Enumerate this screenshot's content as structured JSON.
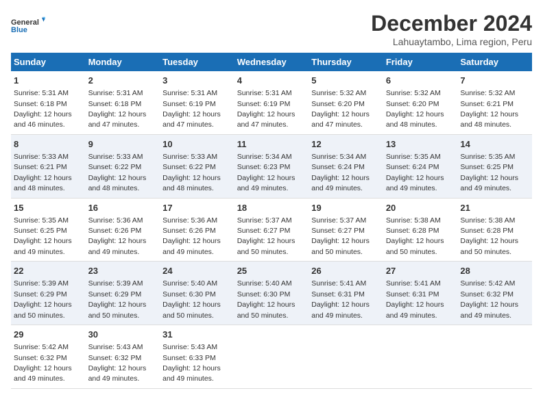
{
  "logo": {
    "general": "General",
    "blue": "Blue"
  },
  "title": "December 2024",
  "subtitle": "Lahuaytambo, Lima region, Peru",
  "weekdays": [
    "Sunday",
    "Monday",
    "Tuesday",
    "Wednesday",
    "Thursday",
    "Friday",
    "Saturday"
  ],
  "weeks": [
    {
      "id": "week1",
      "days": [
        {
          "num": "1",
          "sunrise": "5:31 AM",
          "sunset": "6:18 PM",
          "daylight": "12 hours and 46 minutes."
        },
        {
          "num": "2",
          "sunrise": "5:31 AM",
          "sunset": "6:18 PM",
          "daylight": "12 hours and 47 minutes."
        },
        {
          "num": "3",
          "sunrise": "5:31 AM",
          "sunset": "6:19 PM",
          "daylight": "12 hours and 47 minutes."
        },
        {
          "num": "4",
          "sunrise": "5:31 AM",
          "sunset": "6:19 PM",
          "daylight": "12 hours and 47 minutes."
        },
        {
          "num": "5",
          "sunrise": "5:32 AM",
          "sunset": "6:20 PM",
          "daylight": "12 hours and 47 minutes."
        },
        {
          "num": "6",
          "sunrise": "5:32 AM",
          "sunset": "6:20 PM",
          "daylight": "12 hours and 48 minutes."
        },
        {
          "num": "7",
          "sunrise": "5:32 AM",
          "sunset": "6:21 PM",
          "daylight": "12 hours and 48 minutes."
        }
      ]
    },
    {
      "id": "week2",
      "days": [
        {
          "num": "8",
          "sunrise": "5:33 AM",
          "sunset": "6:21 PM",
          "daylight": "12 hours and 48 minutes."
        },
        {
          "num": "9",
          "sunrise": "5:33 AM",
          "sunset": "6:22 PM",
          "daylight": "12 hours and 48 minutes."
        },
        {
          "num": "10",
          "sunrise": "5:33 AM",
          "sunset": "6:22 PM",
          "daylight": "12 hours and 48 minutes."
        },
        {
          "num": "11",
          "sunrise": "5:34 AM",
          "sunset": "6:23 PM",
          "daylight": "12 hours and 49 minutes."
        },
        {
          "num": "12",
          "sunrise": "5:34 AM",
          "sunset": "6:24 PM",
          "daylight": "12 hours and 49 minutes."
        },
        {
          "num": "13",
          "sunrise": "5:35 AM",
          "sunset": "6:24 PM",
          "daylight": "12 hours and 49 minutes."
        },
        {
          "num": "14",
          "sunrise": "5:35 AM",
          "sunset": "6:25 PM",
          "daylight": "12 hours and 49 minutes."
        }
      ]
    },
    {
      "id": "week3",
      "days": [
        {
          "num": "15",
          "sunrise": "5:35 AM",
          "sunset": "6:25 PM",
          "daylight": "12 hours and 49 minutes."
        },
        {
          "num": "16",
          "sunrise": "5:36 AM",
          "sunset": "6:26 PM",
          "daylight": "12 hours and 49 minutes."
        },
        {
          "num": "17",
          "sunrise": "5:36 AM",
          "sunset": "6:26 PM",
          "daylight": "12 hours and 49 minutes."
        },
        {
          "num": "18",
          "sunrise": "5:37 AM",
          "sunset": "6:27 PM",
          "daylight": "12 hours and 50 minutes."
        },
        {
          "num": "19",
          "sunrise": "5:37 AM",
          "sunset": "6:27 PM",
          "daylight": "12 hours and 50 minutes."
        },
        {
          "num": "20",
          "sunrise": "5:38 AM",
          "sunset": "6:28 PM",
          "daylight": "12 hours and 50 minutes."
        },
        {
          "num": "21",
          "sunrise": "5:38 AM",
          "sunset": "6:28 PM",
          "daylight": "12 hours and 50 minutes."
        }
      ]
    },
    {
      "id": "week4",
      "days": [
        {
          "num": "22",
          "sunrise": "5:39 AM",
          "sunset": "6:29 PM",
          "daylight": "12 hours and 50 minutes."
        },
        {
          "num": "23",
          "sunrise": "5:39 AM",
          "sunset": "6:29 PM",
          "daylight": "12 hours and 50 minutes."
        },
        {
          "num": "24",
          "sunrise": "5:40 AM",
          "sunset": "6:30 PM",
          "daylight": "12 hours and 50 minutes."
        },
        {
          "num": "25",
          "sunrise": "5:40 AM",
          "sunset": "6:30 PM",
          "daylight": "12 hours and 50 minutes."
        },
        {
          "num": "26",
          "sunrise": "5:41 AM",
          "sunset": "6:31 PM",
          "daylight": "12 hours and 49 minutes."
        },
        {
          "num": "27",
          "sunrise": "5:41 AM",
          "sunset": "6:31 PM",
          "daylight": "12 hours and 49 minutes."
        },
        {
          "num": "28",
          "sunrise": "5:42 AM",
          "sunset": "6:32 PM",
          "daylight": "12 hours and 49 minutes."
        }
      ]
    },
    {
      "id": "week5",
      "days": [
        {
          "num": "29",
          "sunrise": "5:42 AM",
          "sunset": "6:32 PM",
          "daylight": "12 hours and 49 minutes."
        },
        {
          "num": "30",
          "sunrise": "5:43 AM",
          "sunset": "6:32 PM",
          "daylight": "12 hours and 49 minutes."
        },
        {
          "num": "31",
          "sunrise": "5:43 AM",
          "sunset": "6:33 PM",
          "daylight": "12 hours and 49 minutes."
        },
        null,
        null,
        null,
        null
      ]
    }
  ],
  "labels": {
    "sunrise": "Sunrise: ",
    "sunset": "Sunset: ",
    "daylight": "Daylight: "
  }
}
